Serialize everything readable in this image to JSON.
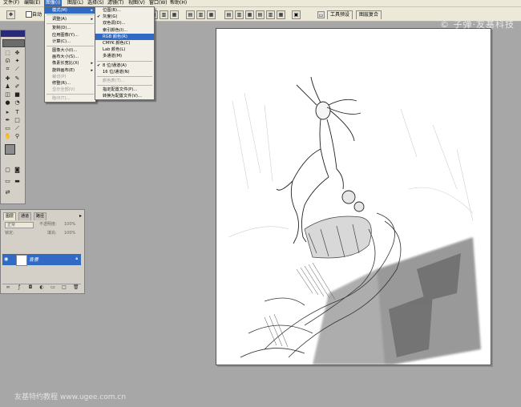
{
  "menubar": {
    "items": [
      "文件(F)",
      "编辑(E)",
      "图像(I)",
      "图层(L)",
      "选择(S)",
      "滤镜(T)",
      "视图(V)",
      "窗口(W)",
      "帮助(H)"
    ]
  },
  "options": {
    "auto_select_label": "自动",
    "well_tabs": [
      "工具预设",
      "图层复合"
    ]
  },
  "image_menu": {
    "items": [
      {
        "label": "模式(M)",
        "arrow": true,
        "highlight": true
      },
      {
        "sep": true
      },
      {
        "label": "调整(A)",
        "arrow": true
      },
      {
        "sep": true
      },
      {
        "label": "复制(D)..."
      },
      {
        "label": "应用图像(Y)..."
      },
      {
        "label": "计算(C)..."
      },
      {
        "sep": true
      },
      {
        "label": "图像大小(I)..."
      },
      {
        "label": "画布大小(S)..."
      },
      {
        "label": "像素长宽比(X)",
        "arrow": true
      },
      {
        "label": "旋转画布(E)",
        "arrow": true
      },
      {
        "label": "裁切(P)",
        "disabled": true
      },
      {
        "label": "修整(R)..."
      },
      {
        "label": "显示全部(V)",
        "disabled": true
      },
      {
        "sep": true
      },
      {
        "label": "陷印(T)...",
        "disabled": true
      }
    ]
  },
  "mode_menu": {
    "items": [
      {
        "label": "位图(B)..."
      },
      {
        "label": "灰度(G)",
        "checked": true
      },
      {
        "label": "双色调(D)..."
      },
      {
        "label": "索引颜色(I)..."
      },
      {
        "label": "RGB 颜色(R)",
        "highlight": true
      },
      {
        "label": "CMYK 颜色(C)"
      },
      {
        "label": "Lab 颜色(L)"
      },
      {
        "label": "多通道(M)"
      },
      {
        "sep": true
      },
      {
        "label": "8 位/通道(A)",
        "checked": true
      },
      {
        "label": "16 位/通道(N)"
      },
      {
        "sep": true
      },
      {
        "label": "颜色表(T)...",
        "disabled": true
      },
      {
        "sep": true
      },
      {
        "label": "指定配置文件(P)..."
      },
      {
        "label": "转换为配置文件(V)..."
      }
    ]
  },
  "layers_panel": {
    "tabs": [
      "图层",
      "通道",
      "路径"
    ],
    "blend_mode": "正常",
    "opacity_label": "不透明度:",
    "opacity_value": "100%",
    "lock_label": "锁定:",
    "fill_label": "填充:",
    "fill_value": "100%",
    "layer_name": "背景"
  },
  "watermarks": {
    "top_right": "© 子弹·友基科技",
    "bottom_left": "友基特约教程  www.ugee.com.cn"
  },
  "colors": {
    "highlight": "#316ac5",
    "chrome": "#ece9d8",
    "workspace": "#a7a7a7"
  }
}
